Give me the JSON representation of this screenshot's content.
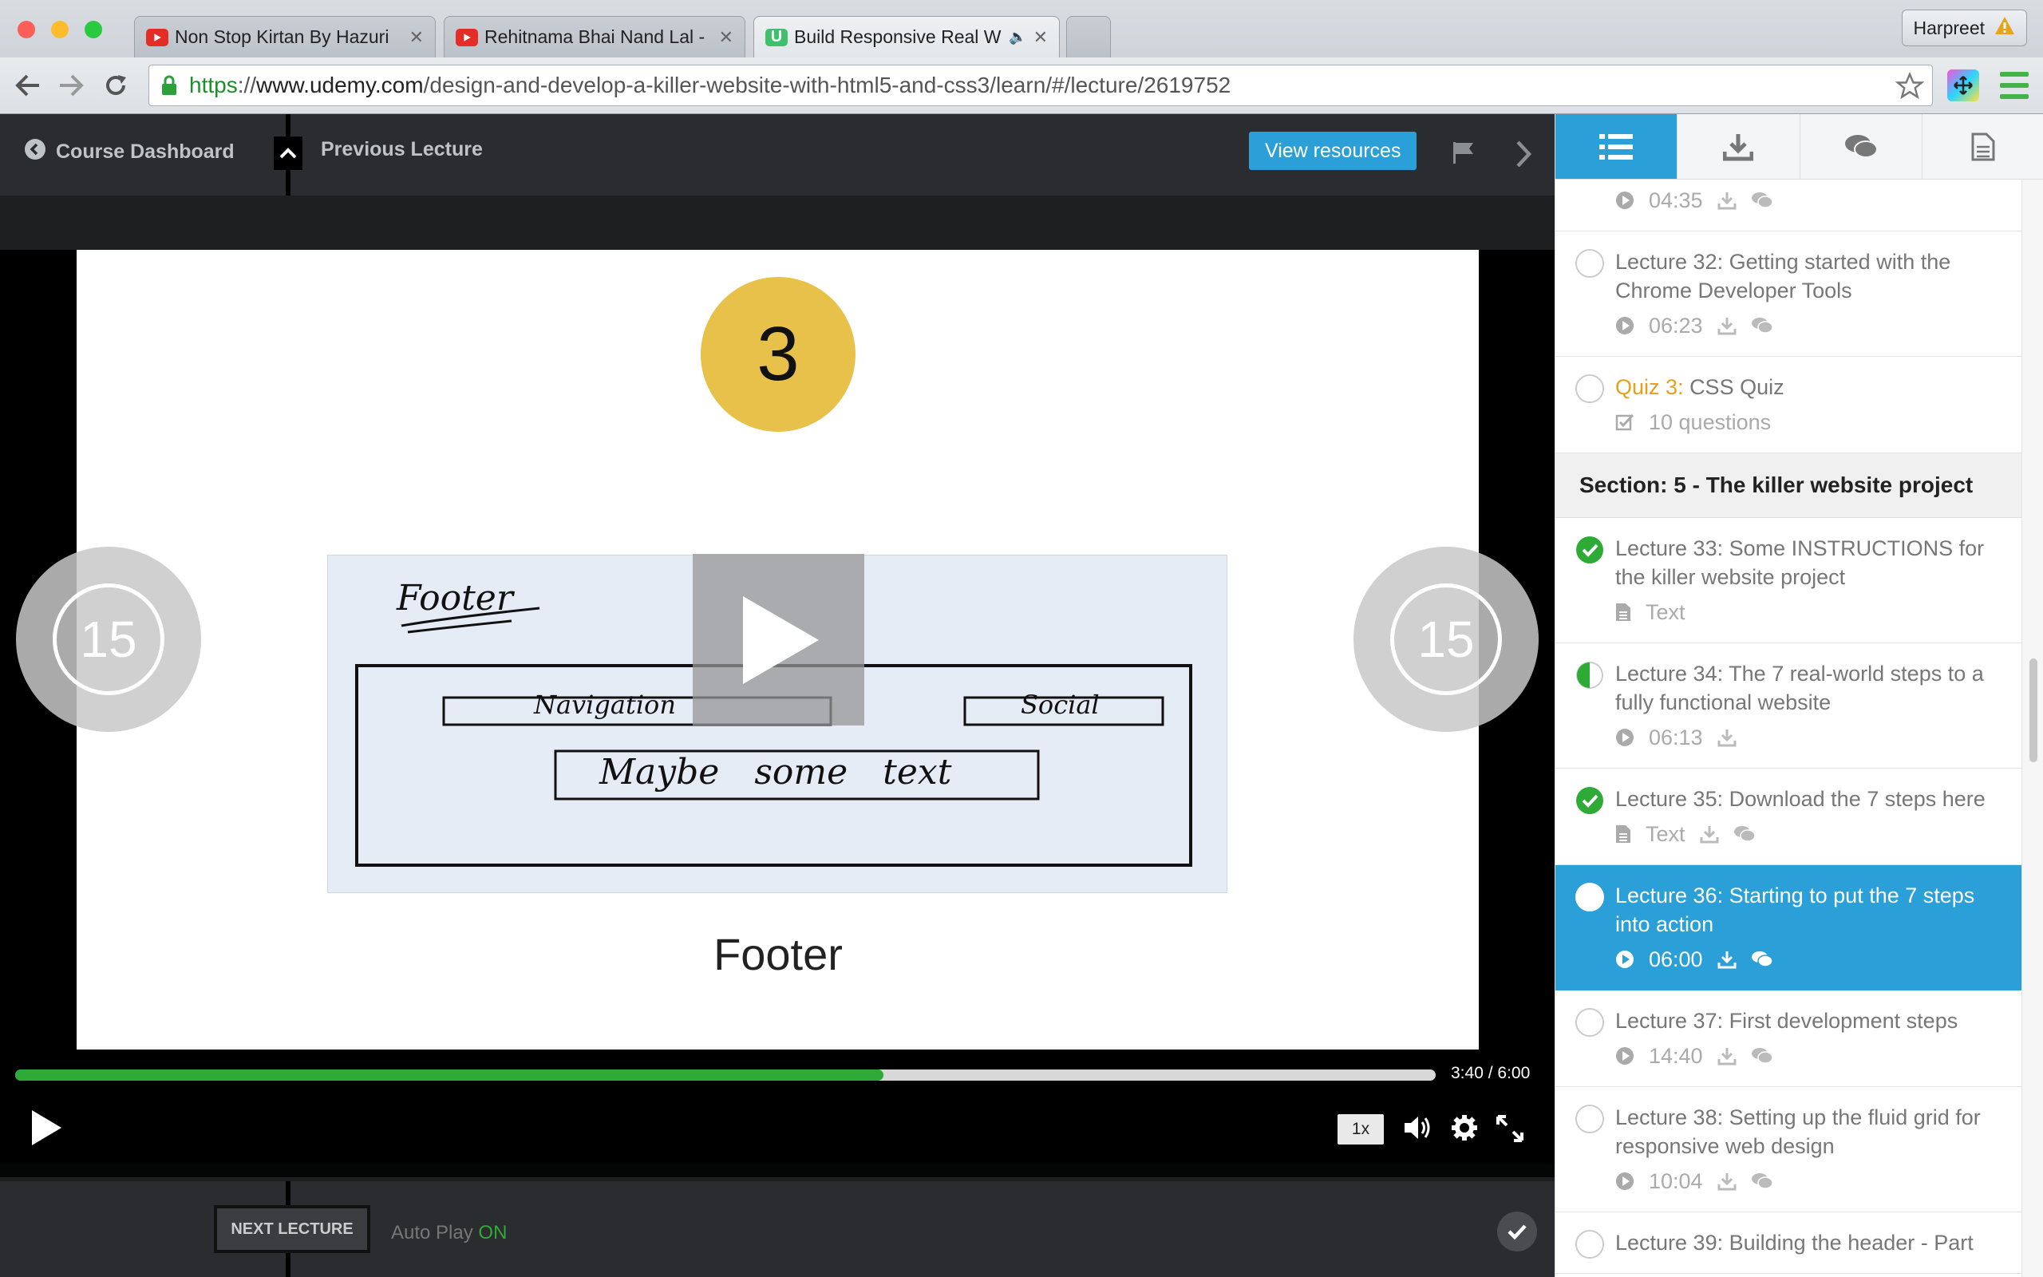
{
  "browser": {
    "tabs": [
      {
        "title": "Non Stop Kirtan By Hazuri",
        "favicon": "youtube-icon"
      },
      {
        "title": "Rehitnama Bhai Nand Lal -",
        "favicon": "youtube-icon"
      },
      {
        "title": "Build Responsive Real W",
        "favicon": "udemy-icon",
        "active": true
      }
    ],
    "profile_name": "Harpreet",
    "url": {
      "scheme": "https",
      "sep": "://",
      "host": "www.udemy.com",
      "path": "/design-and-develop-a-killer-website-with-html5-and-css3/learn/#/lecture/2619752"
    }
  },
  "player": {
    "course_dashboard_label": "Course Dashboard",
    "previous_lecture_label": "Previous Lecture",
    "view_resources_label": "View resources",
    "slide_number": "3",
    "slide_caption": "Footer",
    "sketch_labels": {
      "footer": "Footer",
      "navigation": "Navigation",
      "social": "Social",
      "text": "Maybe some text"
    },
    "seek_back_seconds": "15",
    "seek_forward_seconds": "15",
    "progress_fraction": 0.611,
    "time_display": "3:40 / 6:00",
    "speed_label": "1x",
    "next_lecture_label": "NEXT LECTURE",
    "autoplay_label": "Auto Play",
    "autoplay_state": "ON"
  },
  "sidebar": {
    "tabs": [
      "list-icon",
      "download-icon",
      "comments-icon",
      "document-icon"
    ],
    "items": [
      {
        "type": "meta-only",
        "duration": "04:35"
      },
      {
        "title": "Lecture 32: Getting started with the Chrome Developer Tools",
        "duration": "06:23",
        "status": "none"
      },
      {
        "quiz_prefix": "Quiz 3:",
        "title": "CSS Quiz",
        "detail": "10 questions",
        "status": "none"
      },
      {
        "section": "Section: 5 - The killer website project"
      },
      {
        "title": "Lecture 33: Some INSTRUCTIONS for the killer website project",
        "detail": "Text",
        "status": "complete"
      },
      {
        "title": "Lecture 34: The 7 real-world steps to a fully functional website",
        "duration": "06:13",
        "status": "half"
      },
      {
        "title": "Lecture 35: Download the 7 steps here",
        "detail": "Text",
        "status": "complete"
      },
      {
        "title": "Lecture 36: Starting to put the 7 steps into action",
        "duration": "06:00",
        "status": "current"
      },
      {
        "title": "Lecture 37: First development steps",
        "duration": "14:40",
        "status": "none"
      },
      {
        "title": "Lecture 38: Setting up the fluid grid for responsive web design",
        "duration": "10:04",
        "status": "none"
      },
      {
        "title": "Lecture 39: Building the header - Part"
      }
    ],
    "colors": {
      "accent": "#2a9fd8",
      "complete": "#2eab36",
      "quiz": "#e8a01c"
    }
  }
}
